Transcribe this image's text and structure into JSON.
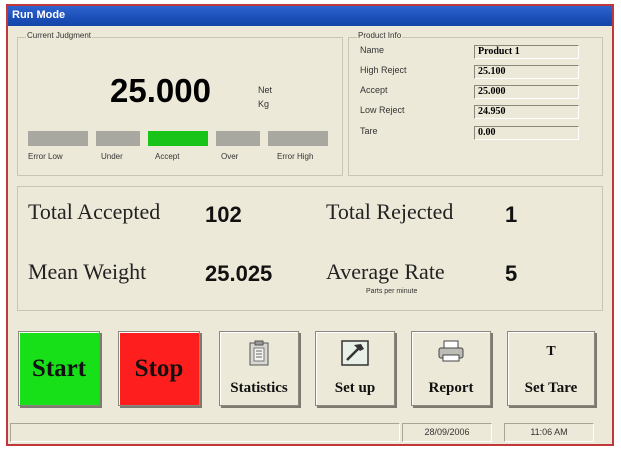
{
  "window": {
    "title": "Run Mode"
  },
  "judgment": {
    "group_title": "Current Judgment",
    "weight": "25.000",
    "unit_line1": "Net",
    "unit_line2": "Kg",
    "segments": [
      {
        "label": "Error Low",
        "active": false
      },
      {
        "label": "Under",
        "active": false
      },
      {
        "label": "Accept",
        "active": true
      },
      {
        "label": "Over",
        "active": false
      },
      {
        "label": "Error High",
        "active": false
      }
    ],
    "active_color": "#18c418",
    "inactive_color": "#a8a8a0"
  },
  "product": {
    "group_title": "Product Info",
    "fields": [
      {
        "label": "Name",
        "value": "Product 1"
      },
      {
        "label": "High Reject",
        "value": "25.100"
      },
      {
        "label": "Accept",
        "value": "25.000"
      },
      {
        "label": "Low Reject",
        "value": "24.950"
      },
      {
        "label": "Tare",
        "value": "0.00"
      }
    ]
  },
  "stats": {
    "total_accepted_label": "Total Accepted",
    "total_accepted_value": "102",
    "total_rejected_label": "Total Rejected",
    "total_rejected_value": "1",
    "mean_weight_label": "Mean Weight",
    "mean_weight_value": "25.025",
    "average_rate_label": "Average Rate",
    "average_rate_value": "5",
    "average_rate_unit": "Parts per minute"
  },
  "buttons": {
    "start": {
      "label": "Start",
      "color": "#18e018"
    },
    "stop": {
      "label": "Stop",
      "color": "#ff1e1e"
    },
    "statistics": {
      "label": "Statistics",
      "icon": "clipboard-icon"
    },
    "setup": {
      "label": "Set up",
      "icon": "hammer-icon"
    },
    "report": {
      "label": "Report",
      "icon": "printer-icon"
    },
    "set_tare": {
      "label": "Set Tare",
      "icon": "tare-t-icon",
      "icon_text": "T"
    }
  },
  "status": {
    "date": "28/09/2006",
    "time": "11:06 AM"
  },
  "colors": {
    "title_bar": "#1a4fb8",
    "window_border": "#c0383b",
    "panel": "#ece9d8"
  }
}
